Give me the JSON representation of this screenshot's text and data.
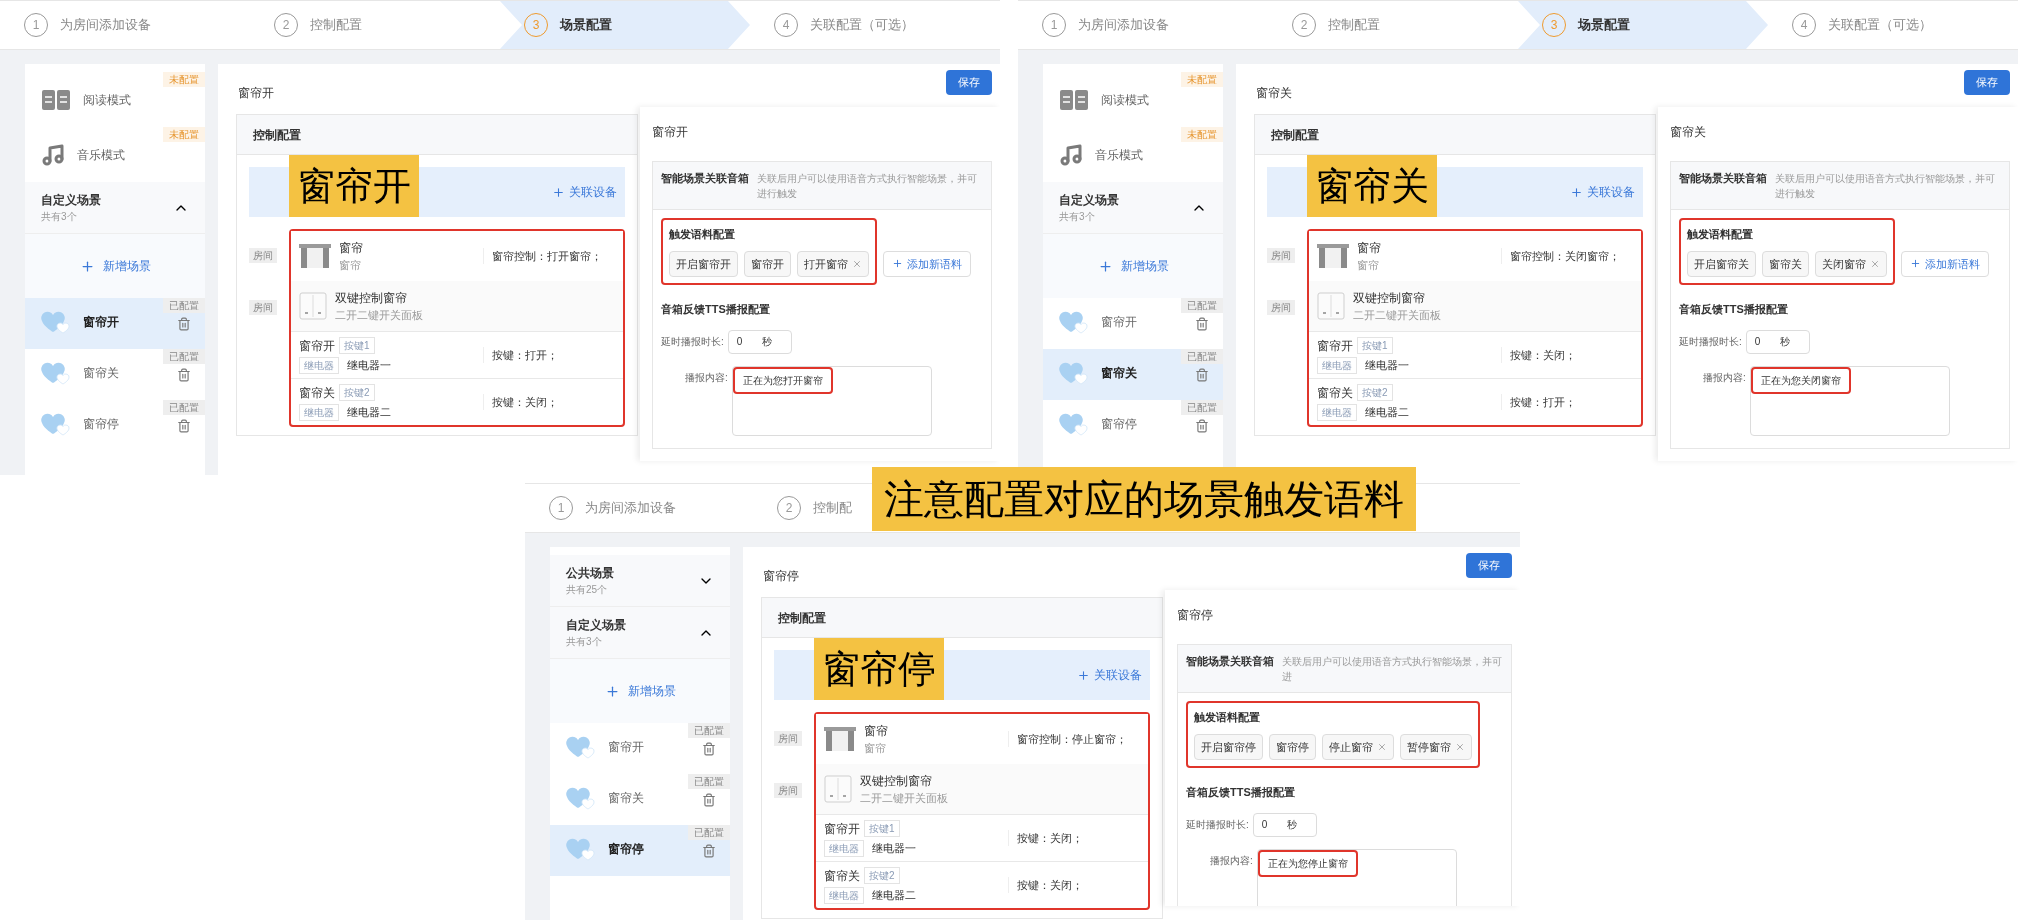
{
  "panels": [
    {
      "stepper": [
        {
          "number": "1",
          "label": "为房间添加设备",
          "selected": false
        },
        {
          "number": "2",
          "label": "控制配置",
          "selected": false
        },
        {
          "number": "3",
          "label": "场景配置",
          "selected": true
        },
        {
          "number": "4",
          "label": "关联配置（可选）",
          "selected": false
        }
      ],
      "sidebar": [
        {
          "kind": "mode",
          "label": "阅读模式",
          "badge": "未配置"
        },
        {
          "kind": "mode",
          "label": "音乐模式",
          "badge": "未配置"
        },
        {
          "kind": "group",
          "label": "自定义场景",
          "count": "共有3个",
          "expanded": true
        },
        {
          "kind": "add",
          "label": "新增场景"
        },
        {
          "kind": "scene",
          "label": "窗帘开",
          "badge": "已配置",
          "selected": true
        },
        {
          "kind": "scene",
          "label": "窗帘关",
          "badge": "已配置",
          "selected": false
        },
        {
          "kind": "scene",
          "label": "窗帘停",
          "badge": "已配置",
          "selected": false
        }
      ],
      "title": "窗帘开",
      "save_label": "保存",
      "control": {
        "title": "控制配置",
        "add_device_label": "关联设备",
        "caption": "窗帘开",
        "devices": [
          {
            "kind": "curtain",
            "room": "房间",
            "name": "窗帘",
            "subtitle": "窗帘",
            "action": "窗帘控制：打开窗帘；"
          },
          {
            "kind": "switch_panel",
            "room": "房间",
            "name": "双键控制窗帘",
            "subtitle": "二开二键开关面板",
            "keys": [
              {
                "name": "窗帘开",
                "key": "按键1",
                "relay_tag": "继电器",
                "relay": "继电器一",
                "action": "按键：打开；"
              },
              {
                "name": "窗帘关",
                "key": "按键2",
                "relay_tag": "继电器",
                "relay": "继电器二",
                "action": "按键：关闭；"
              }
            ]
          }
        ]
      },
      "drawer": {
        "title": "窗帘开",
        "speaker_title": "智能场景关联音箱",
        "speaker_desc": "关联后用户可以使用语音方式执行智能场景，并可进行触发",
        "trigger_title": "触发语料配置",
        "tags": [
          {
            "label": "开启窗帘开",
            "removable": false
          },
          {
            "label": "窗帘开",
            "removable": false
          },
          {
            "label": "打开窗帘",
            "removable": true
          }
        ],
        "add_tag_label": "添加新语料",
        "tts_title": "音箱反馈TTS播报配置",
        "delay_label": "延时播报时长:",
        "delay_value": "0",
        "delay_unit": "秒",
        "content_label": "播报内容:",
        "content": "正在为您打开窗帘"
      }
    },
    {
      "stepper": [
        {
          "number": "1",
          "label": "为房间添加设备",
          "selected": false
        },
        {
          "number": "2",
          "label": "控制配置",
          "selected": false
        },
        {
          "number": "3",
          "label": "场景配置",
          "selected": true
        },
        {
          "number": "4",
          "label": "关联配置（可选）",
          "selected": false
        }
      ],
      "sidebar": [
        {
          "kind": "mode",
          "label": "阅读模式",
          "badge": "未配置"
        },
        {
          "kind": "mode",
          "label": "音乐模式",
          "badge": "未配置"
        },
        {
          "kind": "group",
          "label": "自定义场景",
          "count": "共有3个",
          "expanded": true
        },
        {
          "kind": "add",
          "label": "新增场景"
        },
        {
          "kind": "scene",
          "label": "窗帘开",
          "badge": "已配置",
          "selected": false
        },
        {
          "kind": "scene",
          "label": "窗帘关",
          "badge": "已配置",
          "selected": true
        },
        {
          "kind": "scene",
          "label": "窗帘停",
          "badge": "已配置",
          "selected": false
        }
      ],
      "title": "窗帘关",
      "save_label": "保存",
      "control": {
        "title": "控制配置",
        "add_device_label": "关联设备",
        "caption": "窗帘关",
        "devices": [
          {
            "kind": "curtain",
            "room": "房间",
            "name": "窗帘",
            "subtitle": "窗帘",
            "action": "窗帘控制：关闭窗帘；"
          },
          {
            "kind": "switch_panel",
            "room": "房间",
            "name": "双键控制窗帘",
            "subtitle": "二开二键开关面板",
            "keys": [
              {
                "name": "窗帘开",
                "key": "按键1",
                "relay_tag": "继电器",
                "relay": "继电器一",
                "action": "按键：关闭；"
              },
              {
                "name": "窗帘关",
                "key": "按键2",
                "relay_tag": "继电器",
                "relay": "继电器二",
                "action": "按键：打开；"
              }
            ]
          }
        ]
      },
      "drawer": {
        "title": "窗帘关",
        "speaker_title": "智能场景关联音箱",
        "speaker_desc": "关联后用户可以使用语音方式执行智能场景，并可进行触发",
        "trigger_title": "触发语料配置",
        "tags": [
          {
            "label": "开启窗帘关",
            "removable": false
          },
          {
            "label": "窗帘关",
            "removable": false
          },
          {
            "label": "关闭窗帘",
            "removable": true
          }
        ],
        "add_tag_label": "添加新语料",
        "tts_title": "音箱反馈TTS播报配置",
        "delay_label": "延时播报时长:",
        "delay_value": "0",
        "delay_unit": "秒",
        "content_label": "播报内容:",
        "content": "正在为您关闭窗帘"
      }
    },
    {
      "stepper": [
        {
          "number": "1",
          "label": "为房间添加设备",
          "selected": false
        },
        {
          "number": "2",
          "label": "控制配",
          "selected": false
        }
      ],
      "sidebar": [
        {
          "kind": "group",
          "label": "公共场景",
          "count": "共有25个",
          "expanded": false
        },
        {
          "kind": "group",
          "label": "自定义场景",
          "count": "共有3个",
          "expanded": true
        },
        {
          "kind": "add",
          "label": "新增场景"
        },
        {
          "kind": "scene",
          "label": "窗帘开",
          "badge": "已配置",
          "selected": false
        },
        {
          "kind": "scene",
          "label": "窗帘关",
          "badge": "已配置",
          "selected": false
        },
        {
          "kind": "scene",
          "label": "窗帘停",
          "badge": "已配置",
          "selected": true
        }
      ],
      "title": "窗帘停",
      "save_label": "保存",
      "control": {
        "title": "控制配置",
        "add_device_label": "关联设备",
        "caption": "窗帘停",
        "devices": [
          {
            "kind": "curtain",
            "room": "房间",
            "name": "窗帘",
            "subtitle": "窗帘",
            "action": "窗帘控制：停止窗帘；"
          },
          {
            "kind": "switch_panel",
            "room": "房间",
            "name": "双键控制窗帘",
            "subtitle": "二开二键开关面板",
            "keys": [
              {
                "name": "窗帘开",
                "key": "按键1",
                "relay_tag": "继电器",
                "relay": "继电器一",
                "action": "按键：关闭；"
              },
              {
                "name": "窗帘关",
                "key": "按键2",
                "relay_tag": "继电器",
                "relay": "继电器二",
                "action": "按键：关闭；"
              }
            ]
          }
        ]
      },
      "drawer": {
        "title": "窗帘停",
        "speaker_title": "智能场景关联音箱",
        "speaker_desc": "关联后用户可以使用语音方式执行智能场景，并可进",
        "trigger_title": "触发语料配置",
        "tags": [
          {
            "label": "开启窗帘停",
            "removable": false
          },
          {
            "label": "窗帘停",
            "removable": false
          },
          {
            "label": "停止窗帘",
            "removable": true
          },
          {
            "label": "暂停窗帘",
            "removable": true
          }
        ],
        "tts_title": "音箱反馈TTS播报配置",
        "delay_label": "延时播报时长:",
        "delay_value": "0",
        "delay_unit": "秒",
        "content_label": "播报内容:",
        "content": "正在为您停止窗帘"
      }
    }
  ],
  "banner": "注意配置对应的场景触发语料"
}
